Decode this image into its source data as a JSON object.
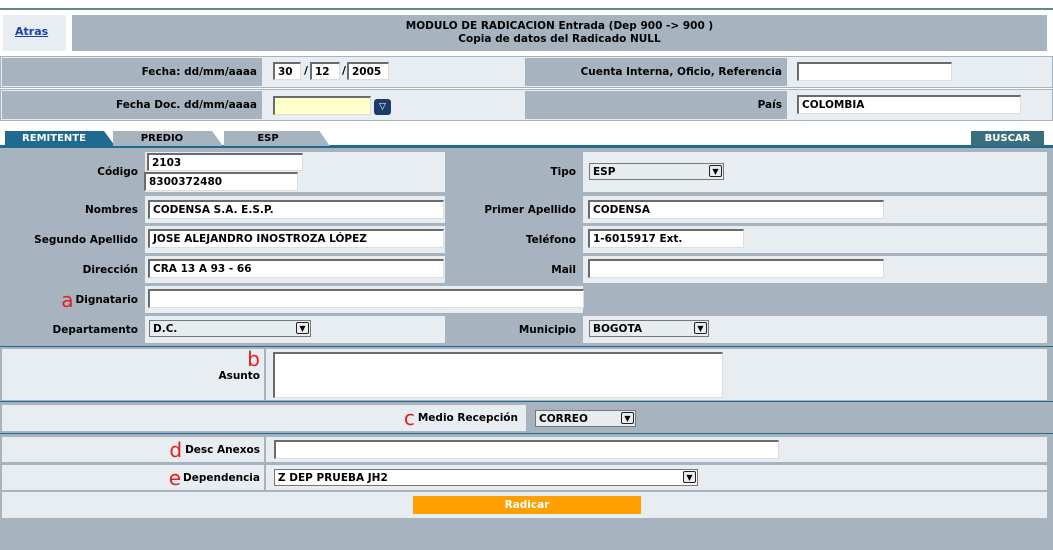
{
  "nav": {
    "back_label": "Atras"
  },
  "header": {
    "line1": "MODULO DE RADICACION Entrada (Dep 900 -> 900 )",
    "line2": "Copia de datos del Radicado NULL"
  },
  "fecha": {
    "label": "Fecha: dd/mm/aaaa",
    "day": "30",
    "month": "12",
    "year": "2005",
    "sep": "/"
  },
  "cuenta": {
    "label": "Cuenta Interna, Oficio, Referencia",
    "value": ""
  },
  "fecha_doc": {
    "label": "Fecha Doc. dd/mm/aaaa",
    "value": ""
  },
  "pais": {
    "label": "País",
    "value": "COLOMBIA"
  },
  "tabs": [
    {
      "label": "REMITENTE"
    },
    {
      "label": "PREDIO"
    },
    {
      "label": "ESP"
    }
  ],
  "buscar_label": "BUSCAR",
  "form": {
    "codigo": {
      "label": "Código",
      "value1": "2103",
      "value2": "8300372480"
    },
    "tipo": {
      "label": "Tipo",
      "value": "ESP"
    },
    "nombres": {
      "label": "Nombres",
      "value": "CODENSA S.A. E.S.P."
    },
    "primer_apellido": {
      "label": "Primer Apellido",
      "value": "CODENSA"
    },
    "segundo_apellido": {
      "label": "Segundo Apellido",
      "value": "JOSE ALEJANDRO INOSTROZA LÓPEZ"
    },
    "telefono": {
      "label": "Teléfono",
      "value": "1-6015917 Ext."
    },
    "direccion": {
      "label": "Dirección",
      "value": "CRA 13 A 93 - 66"
    },
    "mail": {
      "label": "Mail",
      "value": ""
    },
    "dignatario": {
      "label": "Dignatario",
      "value": "",
      "mark": "a"
    },
    "departamento": {
      "label": "Departamento",
      "value": "D.C."
    },
    "municipio": {
      "label": "Municipio",
      "value": "BOGOTA"
    }
  },
  "asunto": {
    "label": "Asunto",
    "value": "",
    "mark": "b"
  },
  "medio": {
    "label": "Medio Recepción",
    "value": "CORREO",
    "mark": "c"
  },
  "desc_anexos": {
    "label": "Desc Anexos",
    "value": "",
    "mark": "d"
  },
  "dependencia": {
    "label": "Dependencia",
    "value": "Z DEP PRUEBA JH2",
    "mark": "e"
  },
  "radicar_label": "Radicar",
  "colors": {
    "tab_active": "#1f6a8f",
    "tab_inactive": "#a7b3bf",
    "buscar": "#3c6f7d",
    "radicar": "#ffa000",
    "highlight": "#ffffcc"
  }
}
